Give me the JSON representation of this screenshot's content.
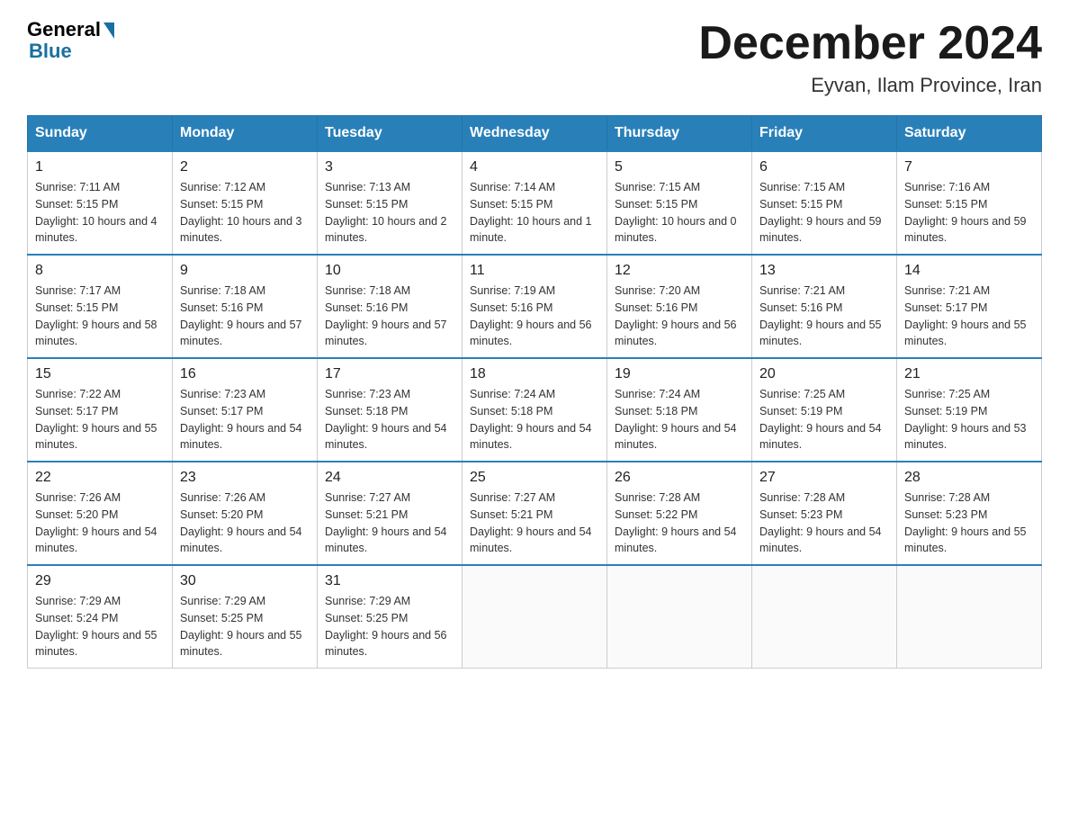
{
  "logo": {
    "general": "General",
    "blue": "Blue"
  },
  "header": {
    "month_year": "December 2024",
    "location": "Eyvan, Ilam Province, Iran"
  },
  "weekdays": [
    "Sunday",
    "Monday",
    "Tuesday",
    "Wednesday",
    "Thursday",
    "Friday",
    "Saturday"
  ],
  "weeks": [
    [
      {
        "day": "1",
        "sunrise": "7:11 AM",
        "sunset": "5:15 PM",
        "daylight": "10 hours and 4 minutes."
      },
      {
        "day": "2",
        "sunrise": "7:12 AM",
        "sunset": "5:15 PM",
        "daylight": "10 hours and 3 minutes."
      },
      {
        "day": "3",
        "sunrise": "7:13 AM",
        "sunset": "5:15 PM",
        "daylight": "10 hours and 2 minutes."
      },
      {
        "day": "4",
        "sunrise": "7:14 AM",
        "sunset": "5:15 PM",
        "daylight": "10 hours and 1 minute."
      },
      {
        "day": "5",
        "sunrise": "7:15 AM",
        "sunset": "5:15 PM",
        "daylight": "10 hours and 0 minutes."
      },
      {
        "day": "6",
        "sunrise": "7:15 AM",
        "sunset": "5:15 PM",
        "daylight": "9 hours and 59 minutes."
      },
      {
        "day": "7",
        "sunrise": "7:16 AM",
        "sunset": "5:15 PM",
        "daylight": "9 hours and 59 minutes."
      }
    ],
    [
      {
        "day": "8",
        "sunrise": "7:17 AM",
        "sunset": "5:15 PM",
        "daylight": "9 hours and 58 minutes."
      },
      {
        "day": "9",
        "sunrise": "7:18 AM",
        "sunset": "5:16 PM",
        "daylight": "9 hours and 57 minutes."
      },
      {
        "day": "10",
        "sunrise": "7:18 AM",
        "sunset": "5:16 PM",
        "daylight": "9 hours and 57 minutes."
      },
      {
        "day": "11",
        "sunrise": "7:19 AM",
        "sunset": "5:16 PM",
        "daylight": "9 hours and 56 minutes."
      },
      {
        "day": "12",
        "sunrise": "7:20 AM",
        "sunset": "5:16 PM",
        "daylight": "9 hours and 56 minutes."
      },
      {
        "day": "13",
        "sunrise": "7:21 AM",
        "sunset": "5:16 PM",
        "daylight": "9 hours and 55 minutes."
      },
      {
        "day": "14",
        "sunrise": "7:21 AM",
        "sunset": "5:17 PM",
        "daylight": "9 hours and 55 minutes."
      }
    ],
    [
      {
        "day": "15",
        "sunrise": "7:22 AM",
        "sunset": "5:17 PM",
        "daylight": "9 hours and 55 minutes."
      },
      {
        "day": "16",
        "sunrise": "7:23 AM",
        "sunset": "5:17 PM",
        "daylight": "9 hours and 54 minutes."
      },
      {
        "day": "17",
        "sunrise": "7:23 AM",
        "sunset": "5:18 PM",
        "daylight": "9 hours and 54 minutes."
      },
      {
        "day": "18",
        "sunrise": "7:24 AM",
        "sunset": "5:18 PM",
        "daylight": "9 hours and 54 minutes."
      },
      {
        "day": "19",
        "sunrise": "7:24 AM",
        "sunset": "5:18 PM",
        "daylight": "9 hours and 54 minutes."
      },
      {
        "day": "20",
        "sunrise": "7:25 AM",
        "sunset": "5:19 PM",
        "daylight": "9 hours and 54 minutes."
      },
      {
        "day": "21",
        "sunrise": "7:25 AM",
        "sunset": "5:19 PM",
        "daylight": "9 hours and 53 minutes."
      }
    ],
    [
      {
        "day": "22",
        "sunrise": "7:26 AM",
        "sunset": "5:20 PM",
        "daylight": "9 hours and 54 minutes."
      },
      {
        "day": "23",
        "sunrise": "7:26 AM",
        "sunset": "5:20 PM",
        "daylight": "9 hours and 54 minutes."
      },
      {
        "day": "24",
        "sunrise": "7:27 AM",
        "sunset": "5:21 PM",
        "daylight": "9 hours and 54 minutes."
      },
      {
        "day": "25",
        "sunrise": "7:27 AM",
        "sunset": "5:21 PM",
        "daylight": "9 hours and 54 minutes."
      },
      {
        "day": "26",
        "sunrise": "7:28 AM",
        "sunset": "5:22 PM",
        "daylight": "9 hours and 54 minutes."
      },
      {
        "day": "27",
        "sunrise": "7:28 AM",
        "sunset": "5:23 PM",
        "daylight": "9 hours and 54 minutes."
      },
      {
        "day": "28",
        "sunrise": "7:28 AM",
        "sunset": "5:23 PM",
        "daylight": "9 hours and 55 minutes."
      }
    ],
    [
      {
        "day": "29",
        "sunrise": "7:29 AM",
        "sunset": "5:24 PM",
        "daylight": "9 hours and 55 minutes."
      },
      {
        "day": "30",
        "sunrise": "7:29 AM",
        "sunset": "5:25 PM",
        "daylight": "9 hours and 55 minutes."
      },
      {
        "day": "31",
        "sunrise": "7:29 AM",
        "sunset": "5:25 PM",
        "daylight": "9 hours and 56 minutes."
      },
      null,
      null,
      null,
      null
    ]
  ],
  "labels": {
    "sunrise": "Sunrise:",
    "sunset": "Sunset:",
    "daylight": "Daylight:"
  }
}
